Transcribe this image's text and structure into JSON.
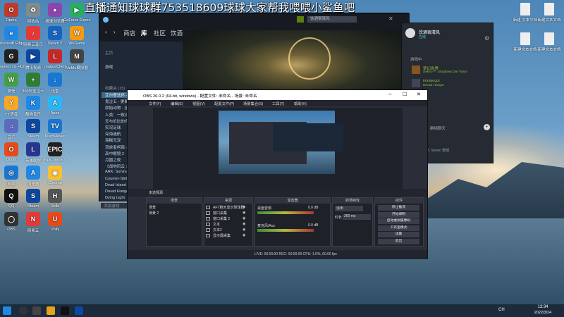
{
  "banner": "直播通知球球群753518609球球大家帮我喂喂小鲨鱼吧",
  "desktop_left": [
    [
      "Opera",
      "#c0392b",
      "O"
    ],
    [
      "回收站",
      "#7f8c8d",
      "♻"
    ],
    [
      "极速浏览器",
      "#8e44ad",
      "●"
    ],
    [
      "GeForce Experience",
      "#27ae60",
      "▶"
    ],
    [
      "Microsoft Edge",
      "#1e88e5",
      "e"
    ],
    [
      "网易云音乐",
      "#e53935",
      "♪"
    ],
    [
      "Steam 2",
      "#1565c0",
      "S"
    ],
    [
      "WeGame",
      "#f39c12",
      "W"
    ],
    [
      "Logitech G HUB",
      "#222",
      "G"
    ],
    [
      "腾讯视频",
      "#0d47a1",
      "▶"
    ],
    [
      "LeagueClient",
      "#c62828",
      "L"
    ],
    [
      "MuMu模拟器",
      "#444",
      "M"
    ],
    [
      "微信",
      "#43a047",
      "W"
    ],
    [
      "360安全卫士",
      "#2e7d32",
      "+"
    ],
    [
      "迅雷",
      "#1976d2",
      "↓"
    ],
    [
      "",
      "#777",
      ""
    ],
    [
      "YY语音",
      "#f9a825",
      "Y"
    ],
    [
      "酷狗音乐",
      "#1e88e5",
      "K"
    ],
    [
      "Apex",
      "#29b6f6",
      "A"
    ],
    [
      "",
      "#777",
      ""
    ],
    [
      "音乐",
      "#5c6bc0",
      "♫"
    ],
    [
      "Steam",
      "#0d47a1",
      "S"
    ],
    [
      "TeamViewer",
      "#1976d2",
      "TV"
    ],
    [
      "",
      "#777",
      ""
    ],
    [
      "Origin",
      "#e64a19",
      "O"
    ],
    [
      "英雄联盟",
      "#283593",
      "L"
    ],
    [
      "Epic Games",
      "#212121",
      "EPIC"
    ],
    [
      "",
      "#777",
      ""
    ],
    [
      "网络",
      "#1976d2",
      "◎"
    ],
    [
      "加速器",
      "#1e88e5",
      "A"
    ],
    [
      "Chrome",
      "#fbc02d",
      "◉"
    ],
    [
      "",
      "#777",
      ""
    ],
    [
      "QQ",
      "#111",
      "Q"
    ],
    [
      "Steam",
      "#0d47a1",
      "S"
    ],
    [
      "Hello",
      "#555",
      "H"
    ],
    [
      "",
      "#777",
      ""
    ],
    [
      "OBS",
      "#333",
      "◯"
    ],
    [
      "网易云",
      "#e53935",
      "N"
    ],
    [
      "Unity",
      "#e64a19",
      "U"
    ]
  ],
  "desktop_right": [
    [
      "新建 文本文档",
      "#eee"
    ],
    [
      "新建文本文档",
      "#eee"
    ],
    [
      "新建文本文档",
      "#eee"
    ],
    [
      "新建文本文档",
      "#eee"
    ]
  ],
  "steam": {
    "title_badge": "饮酒宿清风",
    "nav": [
      "商店",
      "库",
      "社区",
      "饮酒宿清风"
    ],
    "home": "主页",
    "filter": "游戏",
    "collection_header": "收藏夹 (15)",
    "games": [
      "艾尔登法环 - 正在运行",
      "鬼泣五 - 更新已暂停",
      "原始动物 - 全部内容已暂停",
      "人类：一败涂地 / Human",
      "无与伦比的命运之子",
      "实况足球",
      "深海迷航",
      "海贼无双",
      "流放者柯南 - 正在更新",
      "高中眼镜 2",
      "月圆之夜",
      "《战地风云 1》",
      "ARK: Survival Evolved",
      "Counter-Strike: Global Offensive",
      "Dead Island Definitive",
      "Dread Hunger",
      "Dying Light"
    ],
    "add_game": "添加游戏"
  },
  "friends": {
    "user": "饮酒宿清风",
    "status": "在线",
    "section": "游戏中",
    "list": [
      {
        "name": "梦幻世界",
        "game": "Sekiro™: Shadows Die Twice"
      },
      {
        "name": "imoiaogui",
        "game": "Dread Hunger"
      }
    ],
    "section2": "群组聊天",
    "hint": "加入 Steam 群组"
  },
  "obs": {
    "title": "OBS 26.0.2 (64-bit, windows) - 配置文件: 未命名 - 场景: 未命名",
    "menu": [
      "文件(F)",
      "编辑(E)",
      "视图(V)",
      "配置文件(P)",
      "场景集合(S)",
      "工具(T)",
      "帮助(H)"
    ],
    "scene_label": "未选择源",
    "panel_titles": [
      "场景",
      "来源",
      "混音器",
      "转场特效",
      "控件"
    ],
    "scenes": [
      "场景",
      "场景 2"
    ],
    "sources": [
      "AFT聊天显示球球群",
      "窗口采集",
      "窗口采集 2",
      "文本",
      "文本2",
      "显示器采集"
    ],
    "mixer": [
      {
        "name": "桌面音频",
        "db": "0.0 dB"
      },
      {
        "name": "麦克风/Aux",
        "db": "0.0 dB"
      }
    ],
    "transition": "淡出",
    "duration_label": "时长",
    "duration": "300 ms",
    "controls": [
      "停止推流",
      "开始录制",
      "启动虚拟摄像机",
      "工作室模式",
      "设置",
      "退出"
    ],
    "status": "LIVE: 00:00:00   REC: 00:00:00   CPU: 1.0%, 60.00 fps"
  },
  "taskbar": {
    "time": "13:34",
    "date": "2022/3/24",
    "lang": "CH"
  }
}
